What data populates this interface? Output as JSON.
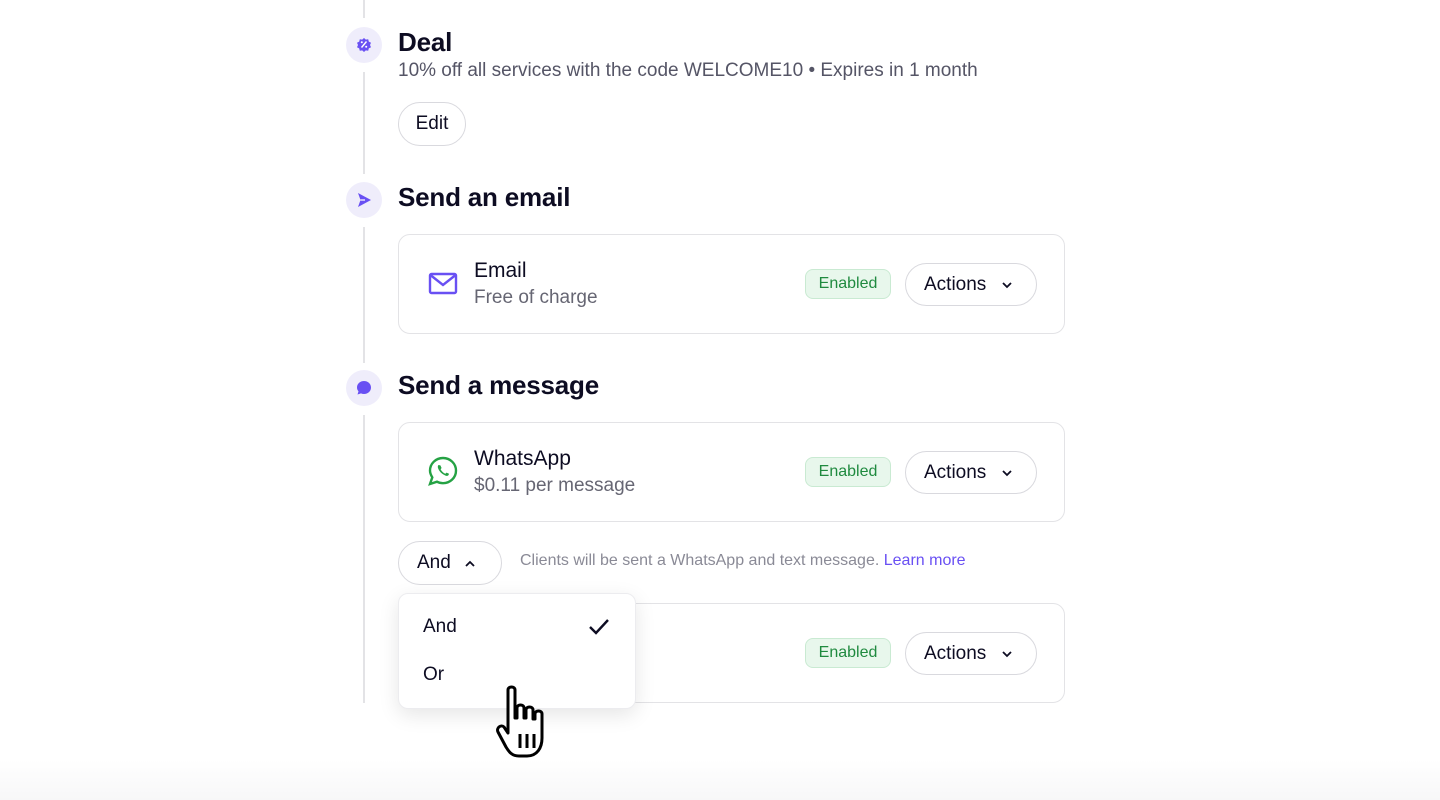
{
  "colors": {
    "accent": "#6950f3",
    "enabled_bg": "#e8f7ec",
    "enabled_text": "#1f8a3f",
    "whatsapp": "#25a244"
  },
  "deal": {
    "icon": "discount-badge-icon",
    "title": "Deal",
    "description": "10% off all services with the code WELCOME10 • Expires in 1 month",
    "edit_label": "Edit"
  },
  "email_section": {
    "icon": "send-arrow-icon",
    "title": "Send an email",
    "card": {
      "icon": "envelope-icon",
      "title": "Email",
      "subtitle": "Free of charge",
      "status": "Enabled",
      "actions_label": "Actions"
    }
  },
  "message_section": {
    "icon": "chat-bubble-icon",
    "title": "Send a message",
    "whatsapp_card": {
      "icon": "whatsapp-icon",
      "title": "WhatsApp",
      "subtitle": "$0.11 per message",
      "status": "Enabled",
      "actions_label": "Actions"
    },
    "condition": {
      "selected": "And",
      "hint": "Clients will be sent a WhatsApp and text message.",
      "learn_more": "Learn more",
      "options": [
        {
          "label": "And",
          "selected": true
        },
        {
          "label": "Or",
          "selected": false
        }
      ]
    },
    "sms_card": {
      "status": "Enabled",
      "actions_label": "Actions"
    }
  }
}
